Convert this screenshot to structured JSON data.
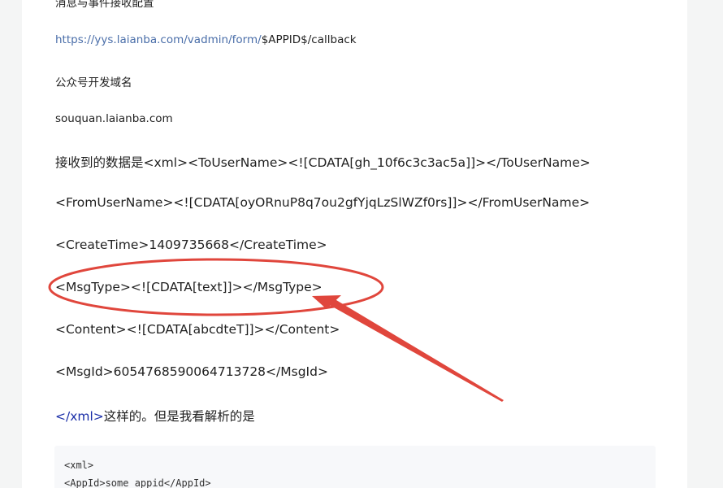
{
  "article": {
    "heading_cut": "消息与事件接收配置",
    "callback_url_link": "https://yys.laianba.com/vadmin/form/",
    "callback_url_suffix": "$APPID$/callback",
    "domain_label": "公众号开发域名",
    "domain_value": "souquan.laianba.com",
    "received_intro": "接收到的数据是",
    "received_line1": "<xml><ToUserName><![CDATA[gh_10f6c3c3ac5a]]></ToUserName>",
    "received_line2": "<FromUserName><![CDATA[oyORnuP8q7ou2gfYjqLzSlWZf0rs]]></FromUserName>",
    "received_line3": "<CreateTime>1409735668</CreateTime>",
    "received_line4": "<MsgType><![CDATA[text]]></MsgType>",
    "received_line5": "<Content><![CDATA[abcdteT]]></Content>",
    "received_line6": "<MsgId>6054768590064713728</MsgId>",
    "closing_tag": "</xml>",
    "closing_text": "这样的。但是我看解析的是"
  },
  "code_block": {
    "line1": "<xml>",
    "line2": "<AppId>some_appid</AppId>"
  },
  "colors": {
    "annotation": "#e0463c",
    "link": "#4a6ea9",
    "tag": "#1a2ea8"
  }
}
